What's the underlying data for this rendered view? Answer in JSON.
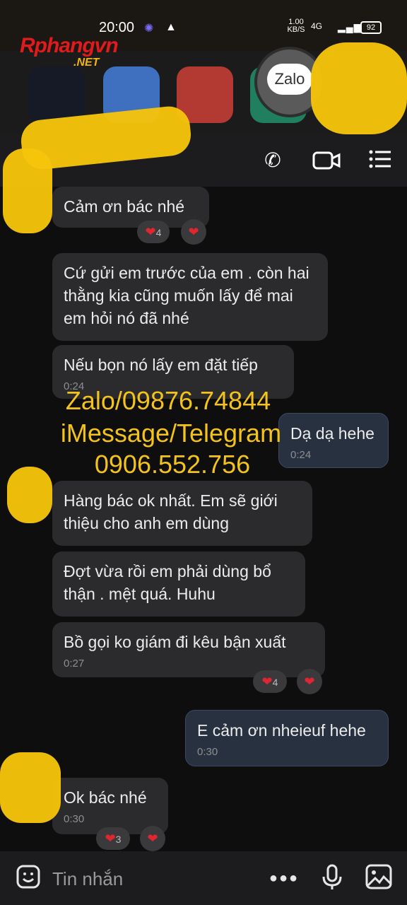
{
  "status_bar": {
    "time": "20:00",
    "net_speed_top": "1.00",
    "net_speed_unit": "KB/S",
    "network": "4G",
    "battery": "92"
  },
  "branding": {
    "logo_main": "Rphangvn",
    "logo_sub": ".NET",
    "zalo_label": "Zalo"
  },
  "header": {
    "call_icon": "phone-icon",
    "video_icon": "video-icon",
    "menu_icon": "list-menu-icon"
  },
  "messages": [
    {
      "text": "Cảm ơn bác nhé",
      "time": "",
      "reaction_count": "4"
    },
    {
      "text": "Cứ gửi em trước của em . còn hai thằng kia cũng muốn lấy để mai em hỏi nó đã nhé",
      "time": ""
    },
    {
      "text": "Nếu bọn nó lấy em đặt tiếp",
      "time": "0:24"
    },
    {
      "text": "Dạ dạ hehe",
      "time": "0:24"
    },
    {
      "text": "Hàng bác ok nhất. Em sẽ giới thiệu cho anh em dùng",
      "time": ""
    },
    {
      "text": "Đợt vừa rồi em phải dùng bổ thận . mệt quá. Huhu",
      "time": ""
    },
    {
      "text": "Bồ gọi ko giám đi kêu bận xuất",
      "time": "0:27",
      "reaction_count": "4"
    },
    {
      "text": "E cảm ơn nheieuf hehe",
      "time": "0:30"
    },
    {
      "text": "Ok bác nhé",
      "time": "0:30",
      "reaction_count": "3"
    }
  ],
  "watermark": {
    "line1": "Zalo/09876.74844",
    "line2": "iMessage/Telegram",
    "line3": "0906.552.756"
  },
  "input": {
    "placeholder": "Tin nhắn"
  },
  "colors": {
    "background": "#0e0e0f",
    "bubble_other": "#2b2b2d",
    "bubble_me": "#27313f",
    "watermark": "#f3c21b",
    "heart": "#e0262f"
  }
}
